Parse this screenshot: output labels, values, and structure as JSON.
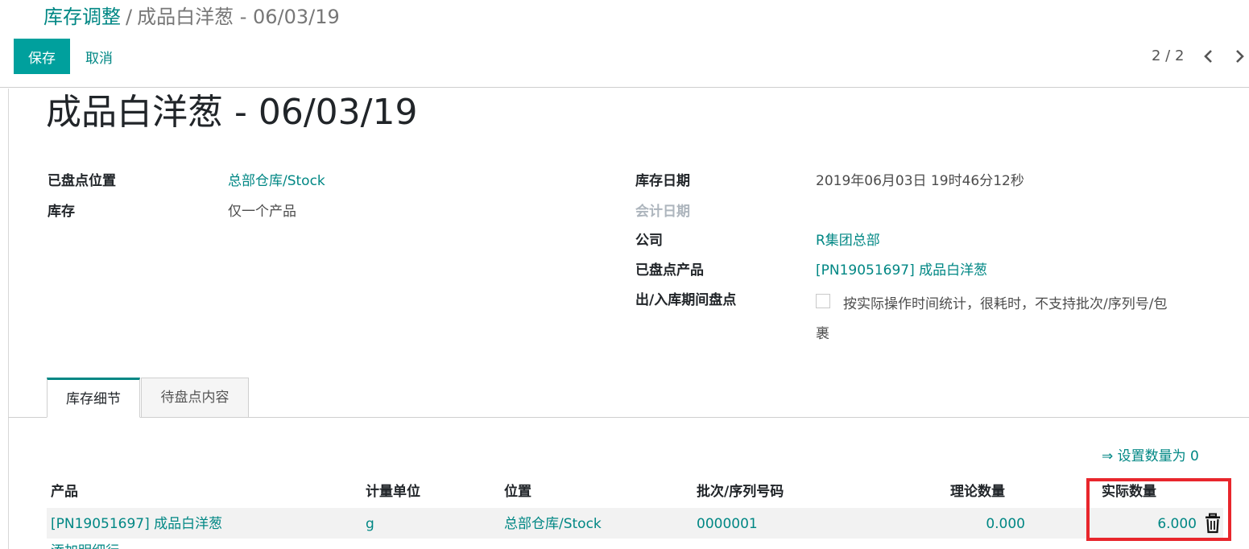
{
  "breadcrumb": {
    "parent": "库存调整",
    "separator": "/",
    "current": "成品白洋葱 - 06/03/19"
  },
  "toolbar": {
    "save_label": "保存",
    "cancel_label": "取消"
  },
  "pager": {
    "value": "2 / 2"
  },
  "record": {
    "title": "成品白洋葱 - 06/03/19"
  },
  "fields_left": {
    "location_label": "已盘点位置",
    "location_value": "总部仓库/Stock",
    "inventory_label": "库存",
    "inventory_value": "仅一个产品"
  },
  "fields_right": {
    "date_label": "库存日期",
    "date_value": "2019年06月03日 19时46分12秒",
    "accounting_date_label": "会计日期",
    "company_label": "公司",
    "company_value": "R集团总部",
    "product_label": "已盘点产品",
    "product_value": "[PN19051697] 成品白洋葱",
    "moves_label": "出/入库期间盘点",
    "moves_note": "按实际操作时间统计，很耗时，不支持批次/序列号/包裹"
  },
  "tabs": {
    "details": "库存细节",
    "pending": "待盘点内容"
  },
  "actions": {
    "set_zero": "⇒ 设置数量为 0"
  },
  "table": {
    "headers": {
      "product": "产品",
      "uom": "计量单位",
      "location": "位置",
      "lot": "批次/序列号码",
      "theoretical": "理论数量",
      "actual": "实际数量"
    },
    "rows": [
      {
        "product": "[PN19051697] 成品白洋葱",
        "uom": "g",
        "location": "总部仓库/Stock",
        "lot": "0000001",
        "theoretical": "0.000",
        "actual": "6.000"
      }
    ],
    "add_line": "添加明细行"
  },
  "colors": {
    "primary": "#00a09d",
    "link": "#008784",
    "highlight_border": "#e8262c"
  },
  "icons": {
    "prev": "chevron-left-icon",
    "next": "chevron-right-icon",
    "delete": "trash-icon"
  }
}
